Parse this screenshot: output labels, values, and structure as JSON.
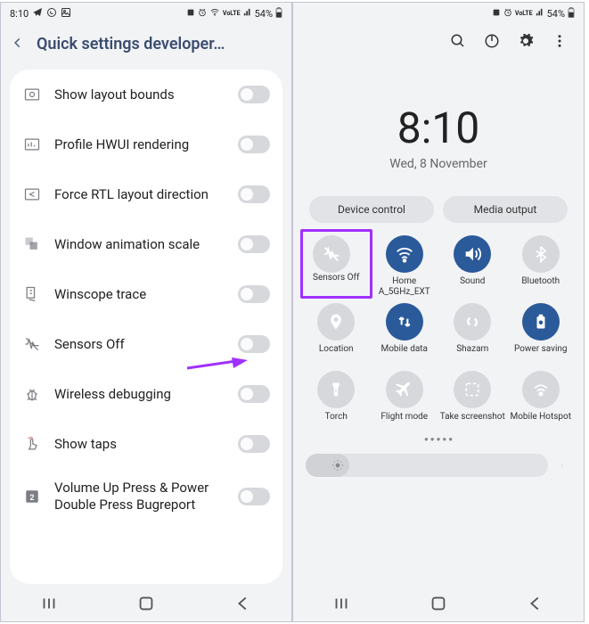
{
  "left": {
    "status": {
      "time": "8:10",
      "battery": "54%"
    },
    "header": {
      "title": "Quick settings developer…"
    },
    "rows": [
      {
        "label": "Show layout bounds"
      },
      {
        "label": "Profile HWUI rendering"
      },
      {
        "label": "Force RTL layout direction"
      },
      {
        "label": "Window animation scale"
      },
      {
        "label": "Winscope trace"
      },
      {
        "label": "Sensors Off"
      },
      {
        "label": "Wireless debugging"
      },
      {
        "label": "Show taps"
      },
      {
        "label": "Volume Up Press & Power Double Press Bugreport"
      }
    ]
  },
  "right": {
    "status": {
      "battery": "54%"
    },
    "clock": {
      "time": "8:10",
      "date": "Wed, 8 November"
    },
    "pills": {
      "device_control": "Device control",
      "media_output": "Media output"
    },
    "tiles": [
      {
        "label": "Sensors Off",
        "active": false,
        "highlight": true
      },
      {
        "label": "Home A_5GHz_EXT",
        "active": true
      },
      {
        "label": "Sound",
        "active": true
      },
      {
        "label": "Bluetooth",
        "active": false
      },
      {
        "label": "Location",
        "active": false
      },
      {
        "label": "Mobile data",
        "active": true
      },
      {
        "label": "Shazam",
        "active": false
      },
      {
        "label": "Power saving",
        "active": true
      },
      {
        "label": "Torch",
        "active": false
      },
      {
        "label": "Flight mode",
        "active": false
      },
      {
        "label": "Take screenshot",
        "active": false
      },
      {
        "label": "Mobile Hotspot",
        "active": false
      }
    ]
  }
}
